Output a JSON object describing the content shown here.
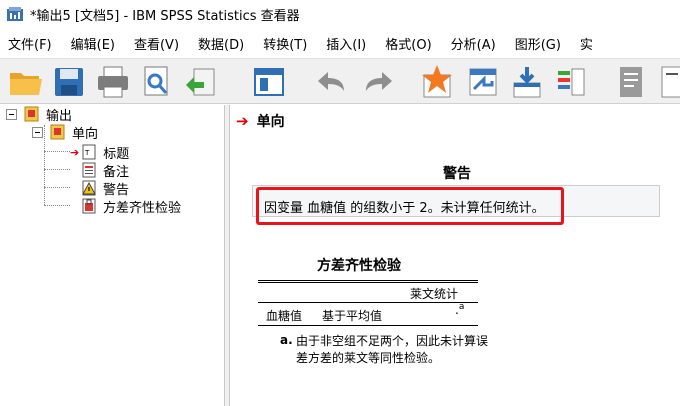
{
  "window": {
    "title": "*输出5 [文档5] - IBM SPSS Statistics 查看器"
  },
  "menu": [
    {
      "label": "文件(F)"
    },
    {
      "label": "编辑(E)"
    },
    {
      "label": "查看(V)"
    },
    {
      "label": "数据(D)"
    },
    {
      "label": "转换(T)"
    },
    {
      "label": "插入(I)"
    },
    {
      "label": "格式(O)"
    },
    {
      "label": "分析(A)"
    },
    {
      "label": "图形(G)"
    },
    {
      "label": "实"
    }
  ],
  "toolbar": {
    "icons": [
      "open-folder-icon",
      "save-icon",
      "print-icon",
      "print-preview-icon",
      "export-icon",
      "recall-dialog-icon",
      "undo-icon",
      "redo-icon",
      "goto-data-icon",
      "goto-case-icon",
      "goto-variable-icon",
      "variables-icon",
      "notes-icon",
      "page-icon"
    ]
  },
  "outline": {
    "root": {
      "label": "输出"
    },
    "group": {
      "label": "单向"
    },
    "items": [
      {
        "label": "标题"
      },
      {
        "label": "备注"
      },
      {
        "label": "警告"
      },
      {
        "label": "方差齐性检验"
      }
    ]
  },
  "content": {
    "section_title": "单向",
    "warning": {
      "title": "警告",
      "text": "因变量 血糖值 的组数小于 2。未计算任何统计。"
    },
    "homogeneity": {
      "title": "方差齐性检验",
      "column_header": "莱文统计",
      "row_label": "血糖值",
      "row_sublabel": "基于平均值",
      "value": ".",
      "value_footnote": "a",
      "footnote_label": "a.",
      "footnote_text": "由于非空组不足两个，因此未计算误差方差的莱文等同性检验。"
    }
  },
  "colors": {
    "highlight": "#e8141d",
    "arrow": "#e00000"
  }
}
